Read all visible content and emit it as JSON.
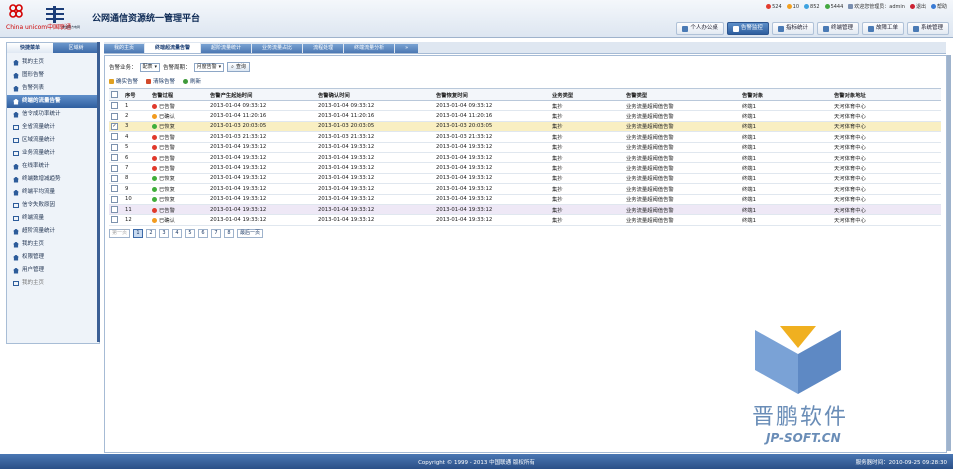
{
  "brand": {
    "logo_cn": "中国联通",
    "logo_en": "China unicom中国联通",
    "partner": "中国南方电网",
    "title": "公网通信资源统一管理平台"
  },
  "status": {
    "counts": [
      {
        "color": "#e23b2e",
        "value": "524"
      },
      {
        "color": "#f2a020",
        "value": "10"
      },
      {
        "color": "#3fa3e0",
        "value": "852"
      },
      {
        "color": "#44a840",
        "value": "5444"
      }
    ],
    "user": "欢迎您管理员：admin",
    "logout": "退出",
    "help": "帮助"
  },
  "topnav": [
    {
      "label": "个人办公桌",
      "active": false
    },
    {
      "label": "告警监控",
      "active": true
    },
    {
      "label": "指标统计",
      "active": false
    },
    {
      "label": "终端管理",
      "active": false
    },
    {
      "label": "故障工单",
      "active": false
    },
    {
      "label": "系统管理",
      "active": false
    }
  ],
  "sidebar": {
    "tabs": [
      "快捷菜单",
      "区域树"
    ],
    "items": [
      {
        "label": "我的主页",
        "icon": "home-icon",
        "on": false
      },
      {
        "label": "图形告警",
        "icon": "home-icon",
        "on": false
      },
      {
        "label": "告警列表",
        "icon": "home-icon",
        "on": false
      },
      {
        "label": "终端的流量告警",
        "icon": "home-icon",
        "on": true
      },
      {
        "label": "信令成功率统计",
        "icon": "home-icon",
        "on": false
      },
      {
        "label": "全省流量统计",
        "icon": "monitor-icon",
        "on": false
      },
      {
        "label": "区域流量统计",
        "icon": "monitor-icon",
        "on": false
      },
      {
        "label": "业务流量统计",
        "icon": "monitor-icon",
        "on": false
      },
      {
        "label": "在线率统计",
        "icon": "home-icon",
        "on": false
      },
      {
        "label": "终端数增减趋势",
        "icon": "home-icon",
        "on": false
      },
      {
        "label": "终端平均流量",
        "icon": "home-icon",
        "on": false
      },
      {
        "label": "信令失败原因",
        "icon": "monitor-icon",
        "on": false
      },
      {
        "label": "终端流量",
        "icon": "monitor-icon",
        "on": false
      },
      {
        "label": "超阶流量统计",
        "icon": "home-icon",
        "on": false
      },
      {
        "label": "我的主页",
        "icon": "home-icon",
        "on": false
      },
      {
        "label": "权限管理",
        "icon": "home-icon",
        "on": false
      },
      {
        "label": "用户管理",
        "icon": "home-icon",
        "on": false
      },
      {
        "label": "我的主页",
        "icon": "monitor-icon",
        "on": false,
        "dim": true
      }
    ]
  },
  "tabs": [
    {
      "label": "我的主页",
      "on": false
    },
    {
      "label": "终端超流量告警",
      "on": true
    },
    {
      "label": "超阶流量统计",
      "on": false
    },
    {
      "label": "业务流量占比",
      "on": false
    },
    {
      "label": "流程处理",
      "on": false
    },
    {
      "label": "终端流量分析",
      "on": false
    },
    {
      "label": "»",
      "on": false
    }
  ],
  "filter": {
    "business_label": "告警业务：",
    "business_value": "配表",
    "period_label": "告警周期：",
    "period_value": "月度告警",
    "query_button": "查询"
  },
  "toolbar": {
    "confirm": "确实告警",
    "clear": "清除告警",
    "refresh": "刷新"
  },
  "table": {
    "columns": [
      "序号",
      "告警过程",
      "告警产生起始时间",
      "告警确认时间",
      "告警恢复时间",
      "业务类型",
      "告警类型",
      "告警对象",
      "告警对象地址"
    ],
    "rows": [
      {
        "checked": false,
        "no": "1",
        "state": "已告警",
        "state_color": "#e03a2c",
        "t1": "2013-01-04 09:33:12",
        "t2": "2013-01-04 09:33:12",
        "t3": "2013-01-04 09:33:12",
        "biz": "集抄",
        "type": "业务流量超阈值告警",
        "obj": "终端1",
        "addr": "天河体育中心"
      },
      {
        "checked": false,
        "no": "2",
        "state": "已确认",
        "state_color": "#f29b1f",
        "t1": "2013-01-04 11:20:16",
        "t2": "2013-01-04 11:20:16",
        "t3": "2013-01-04 11:20:16",
        "biz": "集抄",
        "type": "业务流量超阈值告警",
        "obj": "终端1",
        "addr": "天河体育中心"
      },
      {
        "checked": true,
        "no": "3",
        "state": "已恢复",
        "state_color": "#3fae3b",
        "t1": "2013-01-03 20:03:05",
        "t2": "2013-01-03 20:03:05",
        "t3": "2013-01-03 20:03:05",
        "biz": "集抄",
        "type": "业务流量超阈值告警",
        "obj": "终端1",
        "addr": "天河体育中心"
      },
      {
        "checked": false,
        "no": "4",
        "state": "已告警",
        "state_color": "#e03a2c",
        "t1": "2013-01-03 21:33:12",
        "t2": "2013-01-03 21:33:12",
        "t3": "2013-01-03 21:33:12",
        "biz": "集抄",
        "type": "业务流量超阈值告警",
        "obj": "终端1",
        "addr": "天河体育中心"
      },
      {
        "checked": false,
        "no": "5",
        "state": "已告警",
        "state_color": "#e03a2c",
        "t1": "2013-01-04 19:33:12",
        "t2": "2013-01-04 19:33:12",
        "t3": "2013-01-04 19:33:12",
        "biz": "集抄",
        "type": "业务流量超阈值告警",
        "obj": "终端1",
        "addr": "天河体育中心"
      },
      {
        "checked": false,
        "no": "6",
        "state": "已告警",
        "state_color": "#e03a2c",
        "t1": "2013-01-04 19:33:12",
        "t2": "2013-01-04 19:33:12",
        "t3": "2013-01-04 19:33:12",
        "biz": "集抄",
        "type": "业务流量超阈值告警",
        "obj": "终端1",
        "addr": "天河体育中心"
      },
      {
        "checked": false,
        "no": "7",
        "state": "已告警",
        "state_color": "#e03a2c",
        "t1": "2013-01-04 19:33:12",
        "t2": "2013-01-04 19:33:12",
        "t3": "2013-01-04 19:33:12",
        "biz": "集抄",
        "type": "业务流量超阈值告警",
        "obj": "终端1",
        "addr": "天河体育中心"
      },
      {
        "checked": false,
        "no": "8",
        "state": "已恢复",
        "state_color": "#3fae3b",
        "t1": "2013-01-04 19:33:12",
        "t2": "2013-01-04 19:33:12",
        "t3": "2013-01-04 19:33:12",
        "biz": "集抄",
        "type": "业务流量超阈值告警",
        "obj": "终端1",
        "addr": "天河体育中心"
      },
      {
        "checked": false,
        "no": "9",
        "state": "已恢复",
        "state_color": "#3fae3b",
        "t1": "2013-01-04 19:33:12",
        "t2": "2013-01-04 19:33:12",
        "t3": "2013-01-04 19:33:12",
        "biz": "集抄",
        "type": "业务流量超阈值告警",
        "obj": "终端1",
        "addr": "天河体育中心"
      },
      {
        "checked": false,
        "no": "10",
        "state": "已恢复",
        "state_color": "#3fae3b",
        "t1": "2013-01-04 19:33:12",
        "t2": "2013-01-04 19:33:12",
        "t3": "2013-01-04 19:33:12",
        "biz": "集抄",
        "type": "业务流量超阈值告警",
        "obj": "终端1",
        "addr": "天河体育中心"
      },
      {
        "checked": false,
        "no": "11",
        "state": "已告警",
        "state_color": "#e03a2c",
        "t1": "2013-01-04 19:33:12",
        "t2": "2013-01-04 19:33:12",
        "t3": "2013-01-04 19:33:12",
        "biz": "集抄",
        "type": "业务流量超阈值告警",
        "obj": "终端1",
        "addr": "天河体育中心"
      },
      {
        "checked": false,
        "no": "12",
        "state": "已确认",
        "state_color": "#f29b1f",
        "t1": "2013-01-04 19:33:12",
        "t2": "2013-01-04 19:33:12",
        "t3": "2013-01-04 19:33:12",
        "biz": "集抄",
        "type": "业务流量超阈值告警",
        "obj": "终端1",
        "addr": "天河体育中心"
      }
    ]
  },
  "pager": {
    "first": "第一页",
    "pages": [
      "1",
      "2",
      "3",
      "4",
      "5",
      "6",
      "7",
      "8"
    ],
    "current": "1",
    "last": "最后一页"
  },
  "watermark": {
    "name": "晋鹏软件",
    "url": "JP-SOFT.CN"
  },
  "footer": {
    "copyright": "Copyright © 1999 - 2013    中国联通    版权所有",
    "server_time": "服务器时间：2010-09-25 09:28:30"
  }
}
